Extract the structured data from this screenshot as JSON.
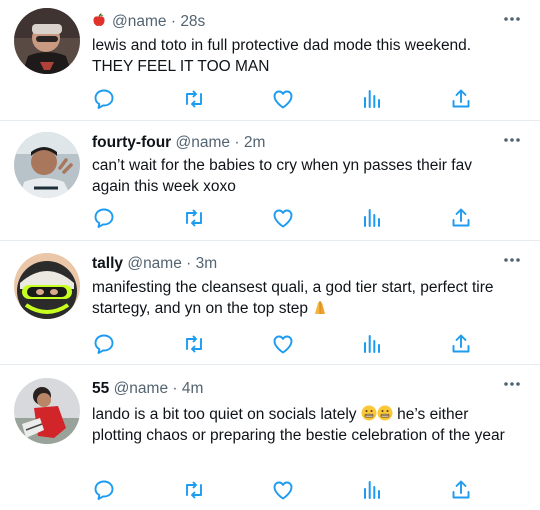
{
  "tweets": [
    {
      "display_name": "",
      "emoji_before_handle": "red-apple",
      "handle": "@name",
      "separator": "·",
      "time": "28s",
      "text": "lewis and toto in full protective dad mode this weekend. THEY FEEL IT TOO MAN"
    },
    {
      "display_name": "fourty-four",
      "handle": "@name",
      "separator": "·",
      "time": "2m",
      "text": "can’t wait for the babies to cry when yn passes their fav again this week xoxo"
    },
    {
      "display_name": "tally",
      "handle": "@name",
      "separator": "·",
      "time": "3m",
      "text": "manifesting the cleansest quali, a god tier start, perfect tire startegy, and yn on the top step",
      "trailing_emoji": "folded-hands"
    },
    {
      "display_name": "55",
      "handle": "@name",
      "separator": "·",
      "time": "4m",
      "text_part1": "lando is a bit too quiet on socials lately",
      "inline_emoji": [
        "grimacing-face",
        "grimacing-face"
      ],
      "text_part2": "he’s either plotting chaos or preparing the bestie celebration of the year"
    }
  ],
  "actions": [
    "reply-icon",
    "retweet-icon",
    "like-icon",
    "views-icon",
    "share-icon"
  ],
  "colors": {
    "icon": "#1d9bf0",
    "text": "#0f1419",
    "muted": "#536471",
    "divider": "#e6ecf0"
  }
}
